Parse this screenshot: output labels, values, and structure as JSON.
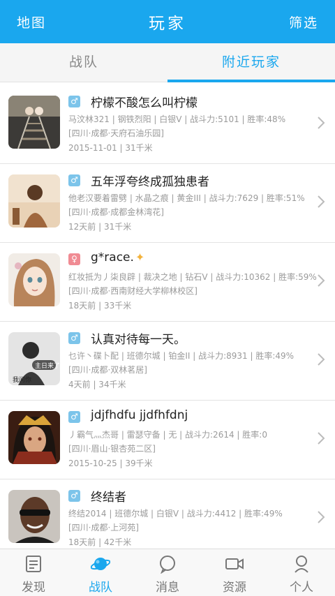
{
  "header": {
    "left": "地图",
    "title": "玩家",
    "right": "筛选"
  },
  "tabs": [
    {
      "label": "战队"
    },
    {
      "label": "附近玩家"
    }
  ],
  "players": [
    {
      "gender": "♂",
      "name": "柠檬不酸怎么叫柠檬",
      "stats": "马汶林321 | 钢铁烈阳 | 白银V | 战斗力:5101 | 胜率:48%",
      "location": "[四川·成都·天府石油乐园]",
      "time_distance": "2015-11-01 | 31千米"
    },
    {
      "gender": "♂",
      "name": "五年浮夸终成孤独患者",
      "stats": "他老汉要着雷劈 | 水晶之痕 | 黄金III | 战斗力:7629 | 胜率:51%",
      "location": "[四川·成都·成都金林湾花]",
      "time_distance": "12天前 | 31千米"
    },
    {
      "gender": "♀",
      "name": "g*race.",
      "stats": "红妆抵为丿柒良辟 | 裁决之地 | 钻石V | 战斗力:10362 | 胜率:59%",
      "location": "[四川·成都·西南财经大学柳林校区]",
      "time_distance": "18天前 | 33千米"
    },
    {
      "gender": "♂",
      "name": "认真对待每一天。",
      "stats": "乜许丶碟卜配 | 班德尔城 | 铂金II | 战斗力:8931 | 胜率:49%",
      "location": "[四川·成都·双林茗居]",
      "time_distance": "4天前 | 34千米"
    },
    {
      "gender": "♂",
      "name": "jdjfhdfu jjdfhfdnj",
      "stats": "丿霸气灬杰哥 | 雷瑟守备 | 无 | 战斗力:2614 | 胜率:0",
      "location": "[四川·眉山·银杏苑二区]",
      "time_distance": "2015-10-25 | 39千米"
    },
    {
      "gender": "♂",
      "name": "终结者",
      "stats": "终结2014 | 班德尔城 | 白银V | 战斗力:4412 | 胜率:49%",
      "location": "[四川·成都·上河苑]",
      "time_distance": "18天前 | 42千米"
    }
  ],
  "avatar4_caption_top": "主日来了",
  "avatar4_caption_bottom": "我问你",
  "bottom_nav": [
    {
      "label": "发现"
    },
    {
      "label": "战队"
    },
    {
      "label": "消息"
    },
    {
      "label": "资源"
    },
    {
      "label": "个人"
    }
  ],
  "colors": {
    "accent": "#1aa7ee",
    "male": "#7cc4ea",
    "female": "#f08b93"
  }
}
